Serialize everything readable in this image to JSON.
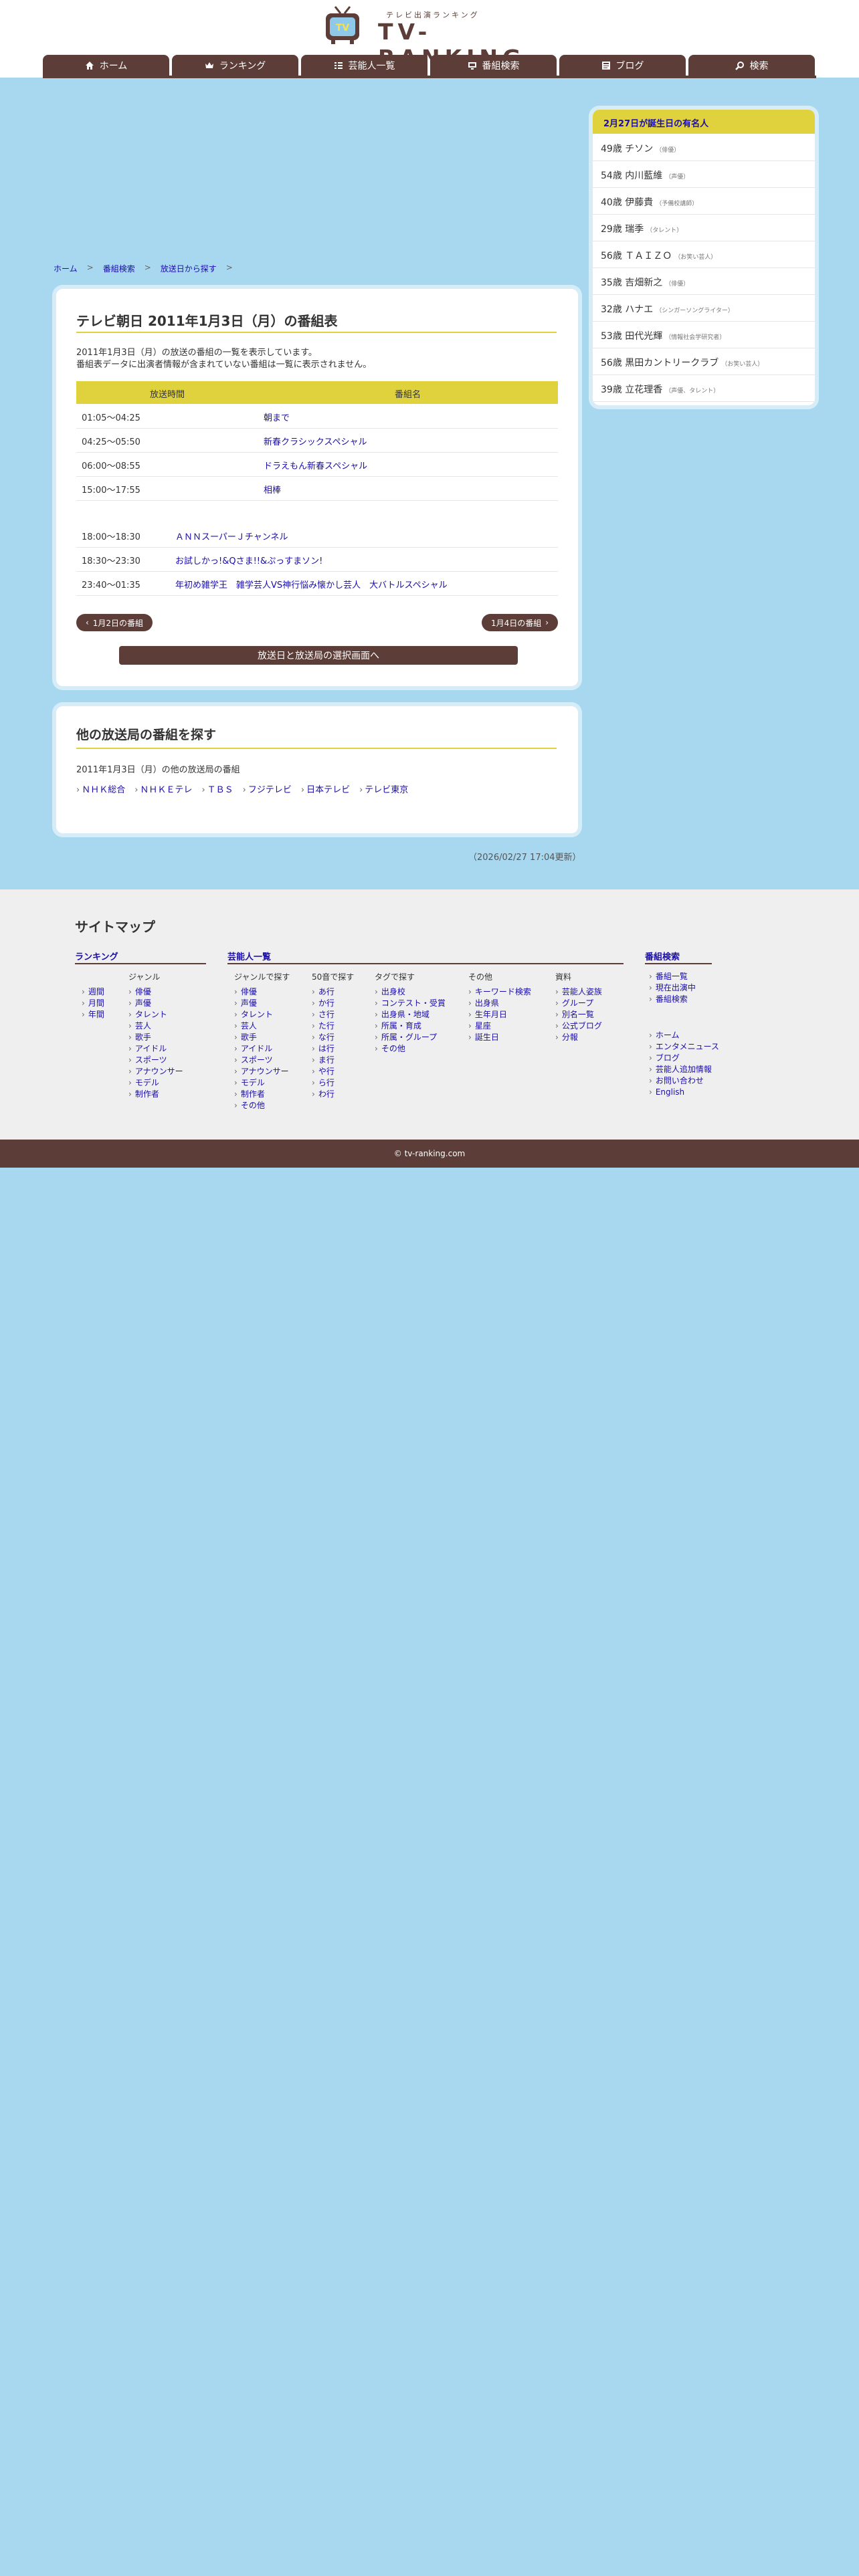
{
  "header": {
    "tagline": "テレビ出演ランキング",
    "logo_text": "TV-RANKING",
    "nav": [
      {
        "label": "ホーム",
        "icon": "home-icon"
      },
      {
        "label": "ランキング",
        "icon": "crown-icon"
      },
      {
        "label": "芸能人一覧",
        "icon": "list-icon"
      },
      {
        "label": "番組検索",
        "icon": "monitor-icon"
      },
      {
        "label": "ブログ",
        "icon": "blog-icon"
      },
      {
        "label": "検索",
        "icon": "search-icon"
      }
    ]
  },
  "breadcrumb": [
    "ホーム",
    "番組検索",
    "放送日から探す"
  ],
  "schedule": {
    "title": "テレビ朝日 2011年1月3日（月）の番組表",
    "intro_1": "2011年1月3日（月）の放送の番組の一覧を表示しています。",
    "intro_2": "番組表データに出演者情報が含まれていない番組は一覧に表示されません。",
    "col_time": "放送時間",
    "col_program": "番組名",
    "rows": [
      {
        "time": "01:05〜04:25",
        "program": "朝まで"
      },
      {
        "time": "04:25〜05:50",
        "program": "新春クラシックスペシャル"
      },
      {
        "time": "06:00〜08:55",
        "program": "ドラえもん新春スペシャル"
      },
      {
        "time": "15:00〜17:55",
        "program": "相棒"
      },
      {
        "time": "18:00〜18:30",
        "program": "ＡＮＮスーパーＪチャンネル"
      },
      {
        "time": "18:30〜23:30",
        "program": "お試しかっ!&Qさま!!&ぷっすまソン!"
      },
      {
        "time": "23:40〜01:35",
        "program": "年初め雑学王　雑学芸人VS神行悩み懐かし芸人　大バトルスペシャル"
      }
    ],
    "prev_label": "1月2日の番組",
    "next_label": "1月4日の番組",
    "select_label": "放送日と放送局の選択画面へ"
  },
  "other": {
    "title": "他の放送局の番組を探す",
    "subtitle": "2011年1月3日（月）の他の放送局の番組",
    "channels": [
      "ＮＨＫ総合",
      "ＮＨＫＥテレ",
      "ＴＢＳ",
      "フジテレビ",
      "日本テレビ",
      "テレビ東京"
    ]
  },
  "updated": "（2026/02/27 17:04更新）",
  "sidebar": {
    "title": "2月27日が誕生日の有名人",
    "items": [
      {
        "name": "49歳 チソン",
        "role": "（俳優）"
      },
      {
        "name": "54歳 内川藍維",
        "role": "（声優）"
      },
      {
        "name": "40歳 伊藤貴",
        "role": "（予備校講師）"
      },
      {
        "name": "29歳 瑞季",
        "role": "（タレント）"
      },
      {
        "name": "56歳 ＴＡＩＺＯ",
        "role": "（お笑い芸人）"
      },
      {
        "name": "35歳 吉畑新之",
        "role": "（俳優）"
      },
      {
        "name": "32歳 ハナエ",
        "role": "（シンガーソングライター）"
      },
      {
        "name": "53歳 田代光輝",
        "role": "（情報社会学研究者）"
      },
      {
        "name": "56歳 黒田カントリークラブ",
        "role": "（お笑い芸人）"
      },
      {
        "name": "39歳 立花理香",
        "role": "（声優、タレント）"
      }
    ]
  },
  "sitemap": {
    "title": "サイトマップ",
    "ranking": {
      "head": "ランキング",
      "periods": [
        "週間",
        "月間",
        "年間"
      ],
      "genre_label": "ジャンル",
      "genres": [
        "俳優",
        "声優",
        "タレント",
        "芸人",
        "歌手",
        "アイドル",
        "スポーツ",
        "アナウンサー",
        "モデル",
        "制作者"
      ]
    },
    "talent": {
      "head": "芸能人一覧",
      "genre_label": "ジャンルで探す",
      "genres": [
        "俳優",
        "声優",
        "タレント",
        "芸人",
        "歌手",
        "アイドル",
        "スポーツ",
        "アナウンサー",
        "モデル",
        "制作者",
        "その他"
      ],
      "kana_label": "50音で探す",
      "kana": [
        "あ行",
        "か行",
        "さ行",
        "た行",
        "な行",
        "は行",
        "ま行",
        "や行",
        "ら行",
        "わ行"
      ],
      "tag_label": "タグで探す",
      "tags": [
        "出身校",
        "コンテスト・受賞",
        "出身県・地域",
        "所属・育成",
        "所属・グループ",
        "その他"
      ],
      "other_label": "その他",
      "others": [
        "キーワード検索",
        "出身県",
        "生年月日",
        "星座",
        "誕生日"
      ],
      "data_label": "資料",
      "data": [
        "芸能人姿族",
        "グループ",
        "別名一覧",
        "公式ブログ",
        "分報"
      ]
    },
    "program": {
      "head": "番組検索",
      "items": [
        "番組一覧",
        "現在出演中",
        "番組検索"
      ],
      "misc": [
        "ホーム",
        "エンタメニュース",
        "ブログ",
        "芸能人追加情報",
        "お問い合わせ",
        "English"
      ]
    }
  },
  "footer": "© tv-ranking.com",
  "colors": {
    "brand": "#5c3d38",
    "accent": "#e0d23c",
    "background": "#a8d8f0"
  }
}
